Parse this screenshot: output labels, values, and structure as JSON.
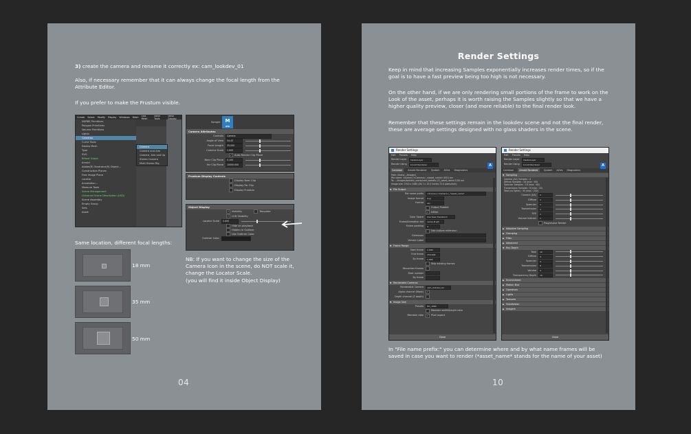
{
  "left_page": {
    "step": "3)",
    "step_text": "create the camera and rename it correctly ex: cam_lookdev_01",
    "para2": "Also, if necessary remember that it can always change the focal length from the Attribute Editor.",
    "para3": "If you prefer to make the Frustum visible.",
    "focal_heading": "Same location, different focal lengths:",
    "focal_lengths": [
      "18 mm",
      "35 mm",
      "50 mm"
    ],
    "note": "NB: If you want to change the size of the Camera Icon in the scene, do NOT scale it, change the Locator Scale.",
    "note2": "(you will find it inside Object Display)",
    "page_number": "04",
    "maya_menu": {
      "bar": [
        "Create",
        "Select",
        "Modify",
        "Display",
        "Windows",
        "Mesh",
        "Edit Mesh",
        "Mesh Tools",
        "Mesh Display"
      ],
      "items": [
        "NURBS Primitives",
        "Polygon Primitives",
        "Volume Primitives",
        "Lights",
        "Cameras",
        "Curve Tools",
        "Sweep Mesh",
        "Type",
        "SVG",
        "Bifrost Graph",
        "Arnold",
        "Adobe(R) Illustrator(R) Object...",
        "Construction Planes",
        "Free Image Plane",
        "Locator",
        "Annotation...",
        "Measure Tools",
        "Scene Management",
        "Universal Scene Description (USD)",
        "Scene Assembly",
        "Empty Group",
        "Sets",
        "Asset"
      ],
      "submenu": [
        "Camera",
        "Camera and Aim",
        "Camera, Aim and Up",
        "Stereo Camera",
        "Multi Stereo Rig"
      ]
    },
    "camera_attrs": {
      "tab": "Sample",
      "section": "Camera Attributes",
      "rows": [
        {
          "label": "Controls",
          "value": "Camera"
        },
        {
          "label": "Angle of View",
          "value": "54.43"
        },
        {
          "label": "Focal Length",
          "value": "35.000"
        },
        {
          "label": "Camera Scale",
          "value": "1.000"
        },
        {
          "label": "Near Clip Plane",
          "value": "0.100"
        },
        {
          "label": "Far Clip Plane",
          "value": "10000.000"
        }
      ],
      "auto_clip": "Auto Render Clip Plane"
    },
    "frustum": {
      "section": "Frustum Display Controls",
      "options": [
        "Display Near Clip",
        "Display Far Clip",
        "Display Frustum"
      ]
    },
    "object_display": {
      "section": "Object Display",
      "visibility": "Visibility",
      "template": "Template",
      "lod": "LOD Visibility",
      "locator_label": "Locator Scale",
      "locator_value": "5.000",
      "options": [
        "Hide on playback",
        "Hidden In Outliner",
        "Use Outliner Color"
      ],
      "outliner_color": "Outliner Color"
    }
  },
  "right_page": {
    "title": "Render Settings",
    "para1": "Keep in mind that increasing Samples exponentially increases render times, so if the goal is to have a fast preview being too high is not necessary.",
    "para2": "On the other hand, if we are only rendering small portions of the frame to work on the Look of the asset, perhaps it is worth raising the Samples slightly so that we have a higher quality preview, closer (and more reliable) to the final render look.",
    "para3": "Remember that these settings remain in the lookdev scene and not the final render, these are average settings designed with no glass shaders in the scene.",
    "caption": "In \"File name prefix:\" you can determine where and by what name frames will be saved in case you want to render (*asset_name* stands for the name of your asset)",
    "page_number": "10",
    "window": {
      "title": "Render Settings",
      "menu": [
        "Edit",
        "Presets",
        "Help"
      ],
      "render_layer_label": "Render Layer",
      "render_layer": "masterLayer",
      "render_using_label": "Render Using",
      "render_using": "Arnold Renderer",
      "close": "Close"
    },
    "common": {
      "tabs": [
        "Common",
        "Arnold Renderer",
        "System",
        "AOVs",
        "Diagnostics"
      ],
      "path_lines": [
        "Path: /Users/.../images/",
        "File name: <Scene>/<Camera>_<asset_name>.0001.exr",
        "To: .../images/lookdev_scene/cam_lookdev_01_asset_name.0150.exr",
        "Image size: 1920 x 1080 (26.7 x 15.0 inches 72.0 pixels/inch)"
      ],
      "file_output": "File Output",
      "rows": [
        {
          "label": "File name prefix",
          "value": "<Scene>/<Camera>_*asset_name*"
        },
        {
          "label": "Image format",
          "value": "png"
        },
        {
          "label": "Format",
          "value": "exr"
        },
        {
          "label": "Color Space",
          "value": "Use View Transform"
        },
        {
          "label": "Frame/Animation ext",
          "value": "name.#.ext"
        },
        {
          "label": "Frame padding",
          "value": "4"
        }
      ],
      "checks": [
        "Output Padded",
        "Dither",
        "Use custom extension"
      ],
      "extension_label": "Extension",
      "version_label": "Version Label",
      "frame_range": "Frame Range",
      "range_rows": [
        {
          "label": "Start frame",
          "value": "1.000"
        },
        {
          "label": "End frame",
          "value": "150.000"
        },
        {
          "label": "By frame",
          "value": "1.000"
        }
      ],
      "skip": "Skip existing frames",
      "renumber": "Renumber frames",
      "start_number": "Start number",
      "by_frame2": "By frame",
      "renderable": "Renderable Cameras",
      "renderable_camera_label": "Renderable Camera",
      "renderable_camera": "cam_lookdev_01",
      "alpha": "Alpha channel (Mask)",
      "depth": "Depth channel (Z depth)",
      "image_size": "Image Size",
      "presets_label": "Presets",
      "presets": "HD_1080",
      "maintain": "Maintain width/height ratio",
      "maintain_ratio": "Maintain ratio",
      "pixel_aspect": "Pixel aspect"
    },
    "arnold": {
      "tabs": [
        "Common",
        "Arnold Renderer",
        "System",
        "AOVs",
        "Diagnostics"
      ],
      "sampling": "Sampling",
      "info": [
        "Camera (AA) Samples : 4",
        "Diffuse Samples : 16 (max : 64)",
        "Specular Samples : 16 (max : 64)",
        "Transmission Samples : 8 (max : 32)",
        "Total (no lights) : 44 (max : 232)"
      ],
      "rows": [
        {
          "label": "Camera (AA)",
          "value": "2"
        },
        {
          "label": "Diffuse",
          "value": "2"
        },
        {
          "label": "Specular",
          "value": "2"
        },
        {
          "label": "Transmission",
          "value": "2"
        },
        {
          "label": "SSS",
          "value": "1"
        },
        {
          "label": "Volume Indirect",
          "value": "1"
        }
      ],
      "progressive": "Progressive Render",
      "closed1": [
        "Adaptive Sampling",
        "Clamping",
        "Filter",
        "Advanced"
      ],
      "ray_depth": "Ray Depth",
      "depth_rows": [
        {
          "label": "Total",
          "value": "10"
        },
        {
          "label": "Diffuse",
          "value": "4"
        },
        {
          "label": "Specular",
          "value": "4"
        },
        {
          "label": "Transmission",
          "value": "8"
        },
        {
          "label": "Volume",
          "value": "0"
        },
        {
          "label": "Transparency Depth",
          "value": "10"
        }
      ],
      "closed2": [
        "Environment",
        "Motion Blur",
        "Operators",
        "Lights",
        "Textures",
        "Subdivision",
        "Imagers"
      ]
    }
  }
}
